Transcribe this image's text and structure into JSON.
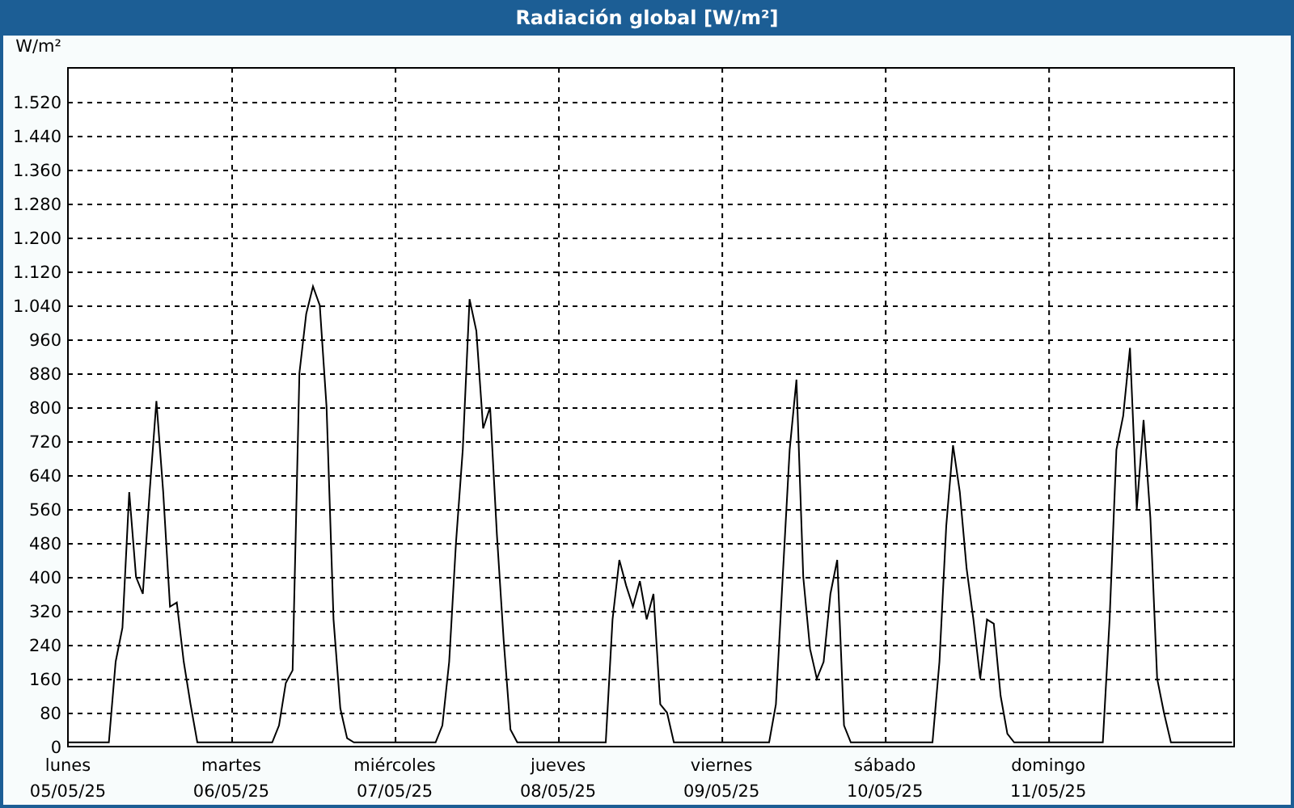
{
  "window": {
    "title": "Radiación global [W/m²]"
  },
  "chart": {
    "weekdays": [
      "lunes",
      "martes",
      "miércoles",
      "jueves",
      "viernes",
      "sábado",
      "domingo"
    ],
    "chart_data": {
      "type": "line",
      "grid": true,
      "ylabel": "W/m²",
      "ylim": [
        0,
        1600
      ],
      "categories": [
        "05/05/25",
        null,
        null,
        null,
        null,
        null,
        null,
        null,
        null,
        null,
        null,
        null,
        null,
        null,
        null,
        null,
        null,
        null,
        null,
        null,
        null,
        null,
        null,
        null,
        "06/05/25",
        null,
        null,
        null,
        null,
        null,
        null,
        null,
        null,
        null,
        null,
        null,
        null,
        null,
        null,
        null,
        null,
        null,
        null,
        null,
        null,
        null,
        null,
        null,
        "07/05/25",
        null,
        null,
        null,
        null,
        null,
        null,
        null,
        null,
        null,
        null,
        null,
        null,
        null,
        null,
        null,
        null,
        null,
        null,
        null,
        null,
        null,
        null,
        null,
        "08/05/25",
        null,
        null,
        null,
        null,
        null,
        null,
        null,
        null,
        null,
        null,
        null,
        null,
        null,
        null,
        null,
        null,
        null,
        null,
        null,
        null,
        null,
        null,
        null,
        "09/05/25",
        null,
        null,
        null,
        null,
        null,
        null,
        null,
        null,
        null,
        null,
        null,
        null,
        null,
        null,
        null,
        null,
        null,
        null,
        null,
        null,
        null,
        null,
        null,
        "10/05/25",
        null,
        null,
        null,
        null,
        null,
        null,
        null,
        null,
        null,
        null,
        null,
        null,
        null,
        null,
        null,
        null,
        null,
        null,
        null,
        null,
        null,
        null,
        null,
        "11/05/25",
        null,
        null,
        null,
        null,
        null,
        null,
        null,
        null,
        null,
        null,
        null,
        null,
        null,
        null,
        null,
        null,
        null,
        null,
        null,
        null,
        null,
        null,
        null,
        null,
        null,
        null,
        null
      ],
      "yticks": [
        {
          "value": 0,
          "label": "0"
        },
        {
          "value": 80,
          "label": "80"
        },
        {
          "value": 160,
          "label": "160"
        },
        {
          "value": 240,
          "label": "240"
        },
        {
          "value": 320,
          "label": "320"
        },
        {
          "value": 400,
          "label": "400"
        },
        {
          "value": 480,
          "label": "480"
        },
        {
          "value": 560,
          "label": "560"
        },
        {
          "value": 640,
          "label": "640"
        },
        {
          "value": 720,
          "label": "720"
        },
        {
          "value": 800,
          "label": "800"
        },
        {
          "value": 880,
          "label": "880"
        },
        {
          "value": 960,
          "label": "960"
        },
        {
          "value": 1040,
          "label": "1.040"
        },
        {
          "value": 1120,
          "label": "1.120"
        },
        {
          "value": 1200,
          "label": "1.200"
        },
        {
          "value": 1280,
          "label": "1.280"
        },
        {
          "value": 1360,
          "label": "1.360"
        },
        {
          "value": 1440,
          "label": "1.440"
        },
        {
          "value": 1520,
          "label": "1.520"
        }
      ],
      "series": [
        {
          "color": "#000000",
          "values": [
            10,
            10,
            10,
            10,
            10,
            10,
            10,
            200,
            280,
            600,
            400,
            360,
            600,
            815,
            600,
            330,
            340,
            200,
            100,
            10,
            10,
            10,
            10,
            10,
            10,
            10,
            10,
            10,
            10,
            10,
            10,
            50,
            150,
            180,
            880,
            1020,
            1085,
            1040,
            800,
            300,
            90,
            20,
            10,
            10,
            10,
            10,
            10,
            10,
            10,
            10,
            10,
            10,
            10,
            10,
            10,
            50,
            200,
            480,
            700,
            1055,
            980,
            750,
            800,
            500,
            250,
            40,
            10,
            10,
            10,
            10,
            10,
            10,
            10,
            10,
            10,
            10,
            10,
            10,
            10,
            10,
            300,
            440,
            380,
            330,
            390,
            300,
            360,
            100,
            80,
            10,
            10,
            10,
            10,
            10,
            10,
            10,
            10,
            10,
            10,
            10,
            10,
            10,
            10,
            10,
            100,
            400,
            700,
            865,
            400,
            230,
            160,
            200,
            360,
            440,
            50,
            10,
            10,
            10,
            10,
            10,
            10,
            10,
            10,
            10,
            10,
            10,
            10,
            10,
            200,
            520,
            710,
            600,
            420,
            300,
            160,
            300,
            290,
            120,
            30,
            10,
            10,
            10,
            10,
            10,
            10,
            10,
            10,
            10,
            10,
            10,
            10,
            10,
            10,
            300,
            700,
            780,
            940,
            560,
            770,
            540,
            160,
            80,
            10,
            10,
            10,
            10,
            10,
            10,
            10,
            10,
            10,
            10
          ]
        }
      ]
    }
  }
}
